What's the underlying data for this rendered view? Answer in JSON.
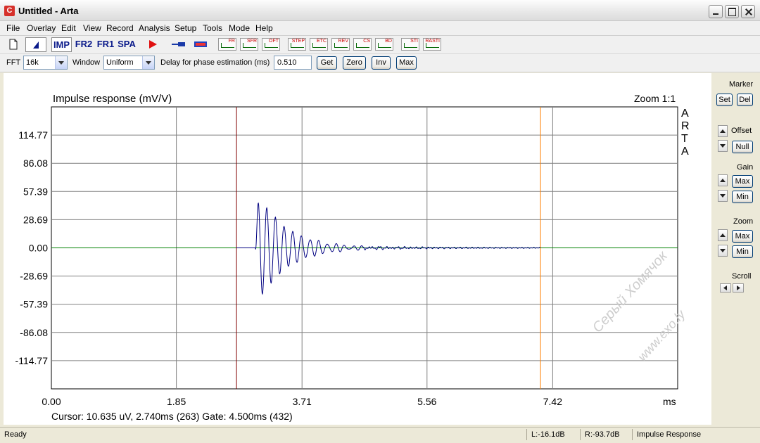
{
  "window": {
    "title": "Untitled - Arta"
  },
  "menu": [
    "File",
    "Overlay",
    "Edit",
    "View",
    "Record",
    "Analysis",
    "Setup",
    "Tools",
    "Mode",
    "Help"
  ],
  "toolbar": {
    "modes": [
      {
        "label": "IMP"
      },
      {
        "label": "FR2"
      },
      {
        "label": "FR1"
      },
      {
        "label": "SPA"
      }
    ],
    "icons": [
      "FR",
      "SFR",
      "OFT",
      "STEP",
      "ETC",
      "REV",
      "CS",
      "BD",
      "STI",
      "RASTI"
    ]
  },
  "options": {
    "fft_label": "FFT",
    "fft_value": "16k",
    "window_label": "Window",
    "window_value": "Uniform",
    "delay_label": "Delay for phase estimation (ms)",
    "delay_value": "0.510",
    "get_label": "Get",
    "zero_label": "Zero",
    "inv_label": "Inv",
    "max_label": "Max"
  },
  "plot": {
    "title": "Impulse response (mV/V)",
    "zoom": "Zoom 1:1",
    "brand": [
      "A",
      "R",
      "T",
      "A"
    ],
    "x_unit": "ms",
    "cursor_text": "Cursor: 10.635 uV, 2.740ms (263)  Gate: 4.500ms (432)"
  },
  "chart_data": {
    "type": "line",
    "series": [
      {
        "name": "",
        "color": "#000080"
      }
    ],
    "x_ticks": [
      "0.00",
      "1.85",
      "3.71",
      "5.56",
      "7.42"
    ],
    "y_ticks": [
      "114.77",
      "86.08",
      "57.39",
      "28.69",
      "0.00",
      "-28.69",
      "-57.39",
      "-86.08",
      "-114.77"
    ],
    "xlim": [
      0,
      9.27
    ],
    "ylim": [
      -143.46,
      143.46
    ],
    "cursor_ms": 2.74,
    "gate_ms": 7.24,
    "grid": true,
    "zero_line_color": "#008000",
    "cursor_color": "#800000",
    "gate_color": "#ff8000"
  },
  "sidebar": {
    "marker_label": "Marker",
    "set_label": "Set",
    "del_label": "Del",
    "offset_label": "Offset",
    "null_label": "Null",
    "gain_label": "Gain",
    "gain_max": "Max",
    "gain_min": "Min",
    "zoom_label": "Zoom",
    "zoom_max": "Max",
    "zoom_min": "Min",
    "scroll_label": "Scroll"
  },
  "status": {
    "ready": "Ready",
    "left": "L:-16.1dB",
    "right": "R:-93.7dB",
    "mode": "Impulse Response"
  },
  "watermark": [
    "Серый Хомячок",
    "www.exo.ly"
  ]
}
